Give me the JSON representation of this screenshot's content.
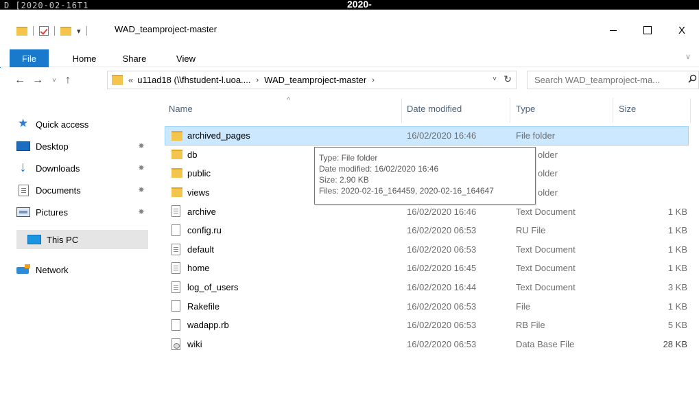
{
  "top_strip": {
    "left_text": "D  [2020-02-16T1",
    "mid_text": "2020-"
  },
  "window": {
    "title": "WAD_teamproject-master",
    "close": "X"
  },
  "quick_access_toolbar": {
    "dropdown": "▾"
  },
  "ribbon": {
    "tabs": [
      "File",
      "Home",
      "Share",
      "View"
    ],
    "expand": "∨"
  },
  "nav_buttons": {
    "back": "←",
    "forward": "→",
    "recent": "˅",
    "up": "↑"
  },
  "address": {
    "overflow": "«",
    "crumbs": [
      "u11ad18 (\\\\fhstudent-l.uoa....",
      "WAD_teamproject-master"
    ],
    "separator": "›",
    "dropdown": "˅",
    "refresh": "↻"
  },
  "search": {
    "placeholder": "Search WAD_teamproject-ma..."
  },
  "nav_pane": {
    "quick_access": "Quick access",
    "pin": "✸",
    "items": [
      {
        "label": "Desktop",
        "icon": "desktop-icon",
        "pinned": true
      },
      {
        "label": "Downloads",
        "icon": "downloads-icon",
        "pinned": true
      },
      {
        "label": "Documents",
        "icon": "documents-icon",
        "pinned": true
      },
      {
        "label": "Pictures",
        "icon": "pictures-icon",
        "pinned": true
      }
    ],
    "this_pc": "This PC",
    "network": "Network"
  },
  "columns": {
    "name": "Name",
    "date": "Date modified",
    "type": "Type",
    "size": "Size",
    "sort_indicator": "^"
  },
  "files": [
    {
      "name": "archived_pages",
      "date": "16/02/2020 16:46",
      "type": "File folder",
      "size": "",
      "icon": "folder-icon"
    },
    {
      "name": "db",
      "date": "",
      "type": "older",
      "size": "",
      "icon": "folder-icon"
    },
    {
      "name": "public",
      "date": "",
      "type": "older",
      "size": "",
      "icon": "folder-icon"
    },
    {
      "name": "views",
      "date": "",
      "type": "older",
      "size": "",
      "icon": "folder-icon"
    },
    {
      "name": "archive",
      "date": "16/02/2020 16:46",
      "type": "Text Document",
      "size": "1 KB",
      "icon": "text-document-icon"
    },
    {
      "name": "config.ru",
      "date": "16/02/2020 06:53",
      "type": "RU File",
      "size": "1 KB",
      "icon": "file-icon"
    },
    {
      "name": "default",
      "date": "16/02/2020 06:53",
      "type": "Text Document",
      "size": "1 KB",
      "icon": "text-document-icon"
    },
    {
      "name": "home",
      "date": "16/02/2020 16:45",
      "type": "Text Document",
      "size": "1 KB",
      "icon": "text-document-icon"
    },
    {
      "name": "log_of_users",
      "date": "16/02/2020 16:44",
      "type": "Text Document",
      "size": "3 KB",
      "icon": "text-document-icon"
    },
    {
      "name": "Rakefile",
      "date": "16/02/2020 06:53",
      "type": "File",
      "size": "1 KB",
      "icon": "file-icon"
    },
    {
      "name": "wadapp.rb",
      "date": "16/02/2020 06:53",
      "type": "RB File",
      "size": "5 KB",
      "icon": "file-icon"
    },
    {
      "name": "wiki",
      "date": "16/02/2020 06:53",
      "type": "Data Base File",
      "size": "28 KB",
      "icon": "database-file-icon"
    }
  ],
  "tooltip": {
    "type": "Type: File folder",
    "date": "Date modified: 16/02/2020 16:46",
    "size": "Size: 2.90 KB",
    "files": "Files: 2020-02-16_164459, 2020-02-16_164647"
  },
  "colors": {
    "accent": "#1979ca",
    "selection": "#cce8ff",
    "selection_border": "#99d1ff",
    "folder": "#f3c54d"
  }
}
